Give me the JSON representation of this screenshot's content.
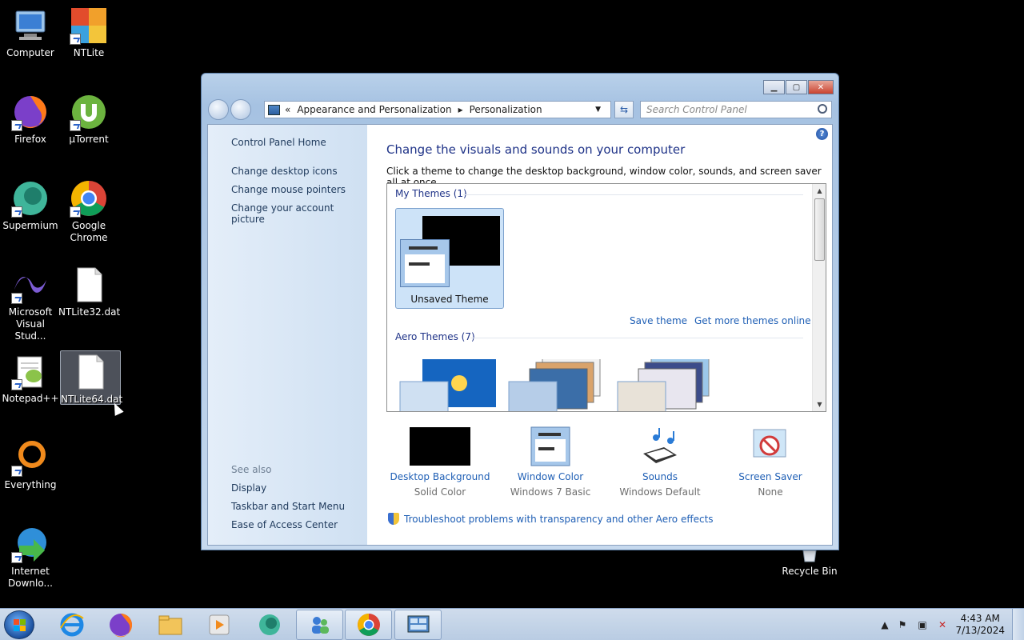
{
  "desktop": {
    "icons": [
      {
        "label": "Computer"
      },
      {
        "label": "NTLite"
      },
      {
        "label": "Firefox"
      },
      {
        "label": "µTorrent"
      },
      {
        "label": "Supermium"
      },
      {
        "label": "Google Chrome"
      },
      {
        "label": "Microsoft Visual Stud..."
      },
      {
        "label": "NTLite32.dat"
      },
      {
        "label": "Notepad++"
      },
      {
        "label": "NTLite64.dat"
      },
      {
        "label": "Everything"
      },
      {
        "label": "Internet Downlo..."
      },
      {
        "label": "Recycle Bin"
      }
    ]
  },
  "window": {
    "breadcrumb": {
      "root": "«",
      "level1": "Appearance and Personalization",
      "sep": "▸",
      "level2": "Personalization"
    },
    "search_placeholder": "Search Control Panel",
    "help": "?",
    "left": {
      "home": "Control Panel Home",
      "links": [
        "Change desktop icons",
        "Change mouse pointers",
        "Change your account picture"
      ],
      "see_also": "See also",
      "see_also_links": [
        "Display",
        "Taskbar and Start Menu",
        "Ease of Access Center"
      ]
    },
    "main": {
      "title": "Change the visuals and sounds on your computer",
      "description": "Click a theme to change the desktop background, window color, sounds, and screen saver all at once.",
      "my_themes_header": "My Themes (1)",
      "unsaved_theme": "Unsaved Theme",
      "save_theme": "Save theme",
      "get_more_themes": "Get more themes online",
      "aero_themes_header": "Aero Themes (7)"
    },
    "bottom": [
      {
        "title": "Desktop Background",
        "sub": "Solid Color"
      },
      {
        "title": "Window Color",
        "sub": "Windows 7 Basic"
      },
      {
        "title": "Sounds",
        "sub": "Windows Default"
      },
      {
        "title": "Screen Saver",
        "sub": "None"
      }
    ],
    "troubleshoot": "Troubleshoot problems with transparency and other Aero effects"
  },
  "taskbar": {
    "time": "4:43 AM",
    "date": "7/13/2024"
  },
  "colors": {
    "link": "#1f5fb5",
    "title": "#1e3287"
  }
}
